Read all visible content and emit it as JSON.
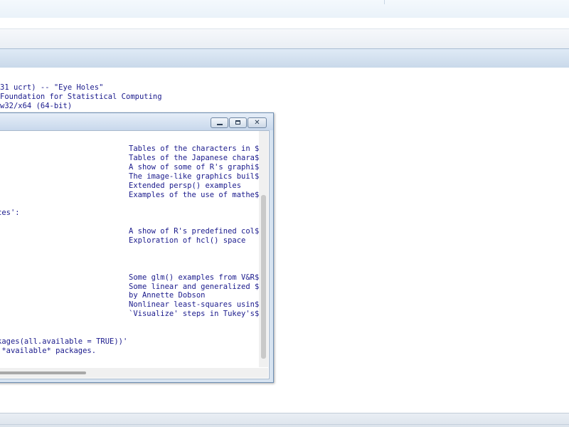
{
  "console": {
    "lines": [
      "31 ucrt) -- \"Eye Holes\"",
      "Foundation for Statistical Computing",
      "w32/x64 (64-bit)"
    ]
  },
  "help_window": {
    "controls": {
      "minimize_icon": "minimize-icon",
      "maximize_icon": "maximize-icon",
      "close_icon": "close-icon"
    },
    "rows": [
      {
        "left": "",
        "desc": "Tables of the characters in $"
      },
      {
        "left": "",
        "desc": "Tables of the Japanese chara$"
      },
      {
        "left": "",
        "desc": "A show of some of R's graphi$"
      },
      {
        "left": "",
        "desc": "The image-like graphics buil$"
      },
      {
        "left": "",
        "desc": "Extended persp() examples"
      },
      {
        "left": "",
        "desc": "Examples of the use of mathe$"
      },
      {
        "left": "",
        "desc": ""
      },
      {
        "left": "ces':",
        "desc": ""
      },
      {
        "left": "",
        "desc": ""
      },
      {
        "left": "",
        "desc": "A show of R's predefined col$"
      },
      {
        "left": "",
        "desc": "Exploration of hcl() space"
      },
      {
        "left": "",
        "desc": ""
      },
      {
        "left": ":",
        "desc": ""
      },
      {
        "left": "",
        "desc": ""
      },
      {
        "left": "",
        "desc": "Some glm() examples from V&R$"
      },
      {
        "left": "",
        "desc": "Some linear and generalized $"
      },
      {
        "left": "",
        "desc": "by Annette Dobson"
      },
      {
        "left": "",
        "desc": "Nonlinear least-squares usin$"
      },
      {
        "left": "",
        "desc": "`Visualize' steps in Tukey's$"
      },
      {
        "left": "",
        "desc": ""
      },
      {
        "left": "",
        "desc": ""
      },
      {
        "left": "kages(all.available = TRUE))'",
        "desc": ""
      },
      {
        "left": " *available* packages.",
        "desc": ""
      }
    ]
  },
  "colors": {
    "console_text": "#1a1a8c",
    "title_gradient_top": "#e6eef8",
    "title_gradient_bottom": "#c8d8ec"
  }
}
